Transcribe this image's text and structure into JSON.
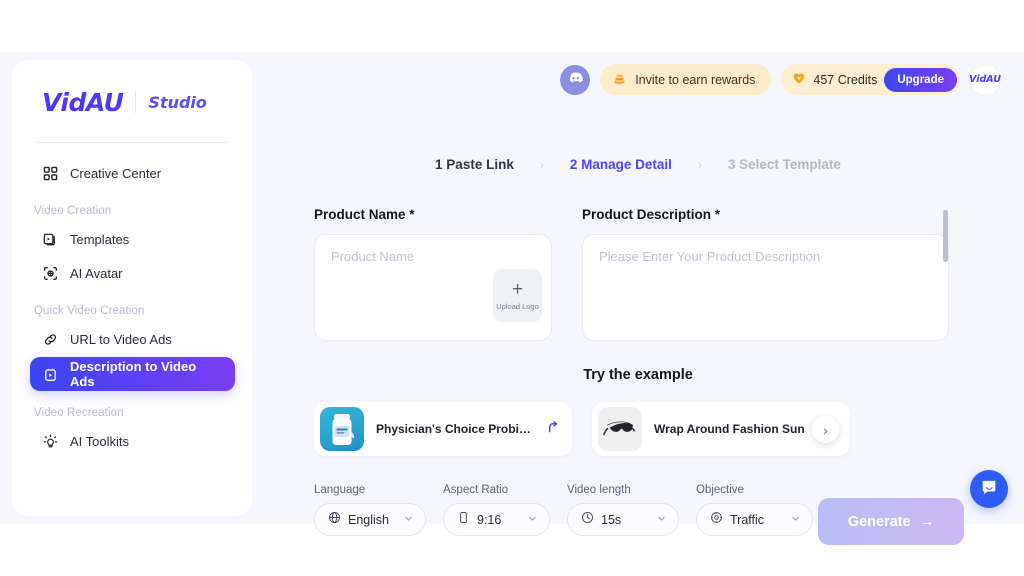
{
  "brand": {
    "logo": "VidAU",
    "product": "Studio"
  },
  "sidebar": {
    "items": [
      {
        "label": "Creative Center",
        "icon": "grid-icon"
      }
    ],
    "groups": [
      {
        "title": "Video Creation",
        "items": [
          {
            "label": "Templates",
            "icon": "templates-icon"
          },
          {
            "label": "AI Avatar",
            "icon": "ai-avatar-icon"
          }
        ]
      },
      {
        "title": "Quick Video Creation",
        "items": [
          {
            "label": "URL to Video Ads",
            "icon": "link-icon"
          },
          {
            "label": "Description to Video Ads",
            "icon": "description-icon",
            "active": true
          }
        ]
      },
      {
        "title": "Video Recreation",
        "items": [
          {
            "label": "AI Toolkits",
            "icon": "lightbulb-icon"
          }
        ]
      }
    ]
  },
  "topbar": {
    "discord_label": "discord-icon",
    "invite_label": "Invite to earn rewards",
    "invite_icon": "coins-icon",
    "credits_label": "457 Credits",
    "credits_icon": "gem-icon",
    "upgrade_label": "Upgrade",
    "avatar_label": "VidAU",
    "colors": {
      "invite_bg": "#fdecc9",
      "credits_bg": "#fdeed2",
      "upgrade_accent": "#4a46f0"
    }
  },
  "steps": [
    {
      "label": "1 Paste Link",
      "state": "done"
    },
    {
      "label": "2 Manage Detail",
      "state": "current"
    },
    {
      "label": "3 Select Template",
      "state": "future"
    }
  ],
  "step_separator": "›",
  "form": {
    "product_name": {
      "label": "Product Name *",
      "value": "",
      "placeholder": "Product Name",
      "upload_label": "Upload Logo",
      "upload_plus": "+"
    },
    "product_description": {
      "label": "Product Description *",
      "value": "",
      "placeholder": "Please Enter Your Product Description"
    }
  },
  "examples": {
    "title": "Try the example",
    "next_label": "›",
    "cards": [
      {
        "name": "Physician's Choice Probiot...",
        "action_icon": "use-example-icon",
        "thumb": "probiotic-bottle-image"
      },
      {
        "name": "Wrap Around Fashion Sun",
        "thumb": "sunglasses-image"
      }
    ]
  },
  "controls": [
    {
      "label": "Language",
      "value": "English",
      "icon": "globe-icon",
      "name": "language-select"
    },
    {
      "label": "Aspect Ratio",
      "value": "9:16",
      "icon": "phone-icon",
      "name": "aspect-ratio-select"
    },
    {
      "label": "Video length",
      "value": "15s",
      "icon": "clock-icon",
      "name": "video-length-select"
    },
    {
      "label": "Objective",
      "value": "Traffic",
      "icon": "target-icon",
      "name": "objective-select"
    }
  ],
  "generate": {
    "label": "Generate",
    "arrow": "→"
  },
  "chat": {
    "icon": "chat-icon"
  }
}
